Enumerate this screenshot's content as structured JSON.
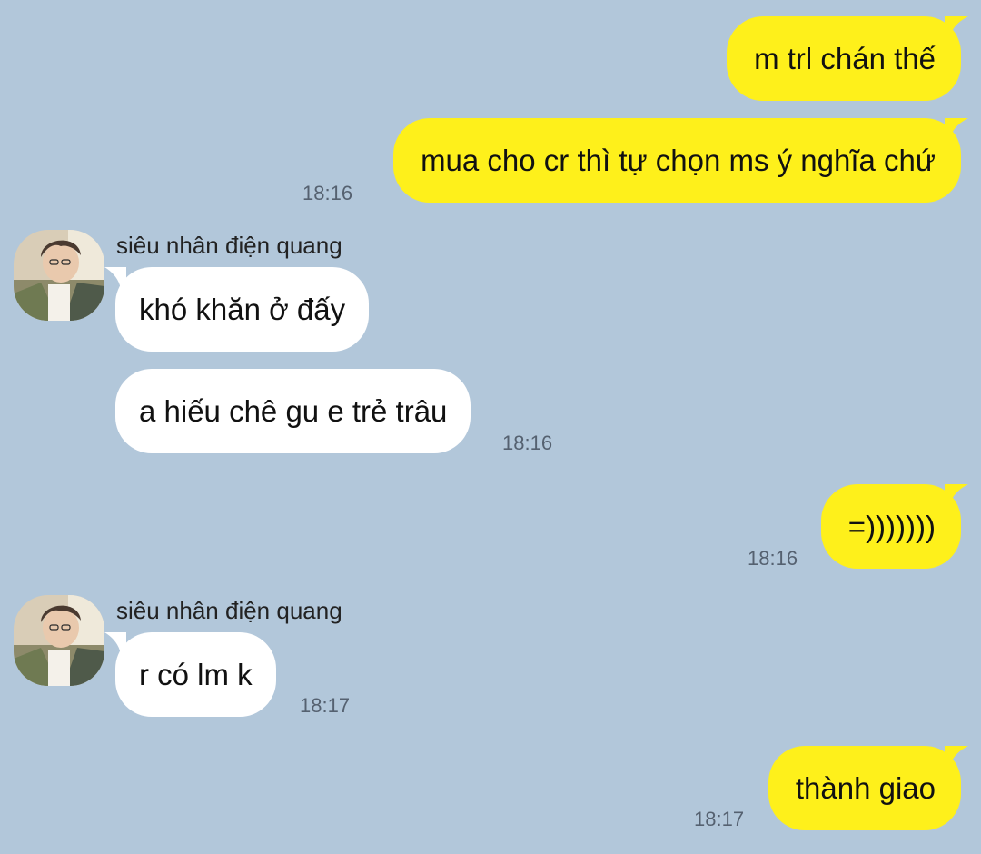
{
  "chat": {
    "messages": [
      {
        "direction": "out",
        "text": "m trl chán thế"
      },
      {
        "direction": "out",
        "text": "mua cho cr thì tự chọn ms ý nghĩa chứ",
        "time": "18:16"
      },
      {
        "direction": "in",
        "sender": "siêu nhân điện quang",
        "text": "khó khăn ở đấy"
      },
      {
        "direction": "in",
        "text": "a hiếu chê gu e trẻ trâu",
        "time": "18:16"
      },
      {
        "direction": "out",
        "text": "=)))))))",
        "time": "18:16"
      },
      {
        "direction": "in",
        "sender": "siêu nhân điện quang",
        "text": "r có lm k",
        "time": "18:17"
      },
      {
        "direction": "out",
        "text": "thành giao",
        "time": "18:17"
      }
    ]
  },
  "colors": {
    "background": "#b2c7da",
    "outgoing_bubble": "#fef01b",
    "incoming_bubble": "#ffffff",
    "timestamp": "#556170"
  },
  "icons": {
    "contact_avatar": "profile-photo"
  }
}
